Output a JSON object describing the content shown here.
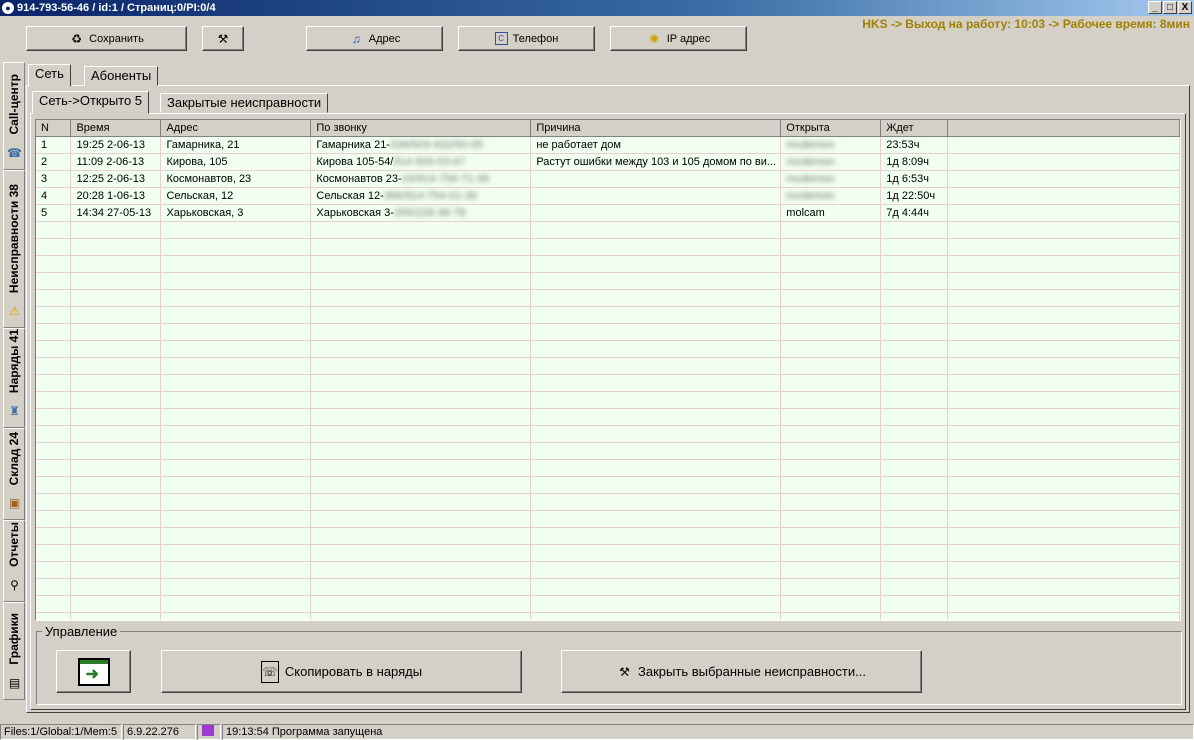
{
  "window": {
    "title": "914-793-56-46 / id:1 / Страниц:0/PI:0/4",
    "controls": [
      "_",
      "□",
      "X"
    ]
  },
  "header_status": "HKS -> Выход на работу: 10:03 -> Рабочее время: 8мин",
  "toolbar": {
    "save": "Сохранить",
    "address": "Адрес",
    "phone": "Телефон",
    "ip": "IP адрес"
  },
  "side_tabs": [
    {
      "label": "Call-центр"
    },
    {
      "label": "Неисправности 38"
    },
    {
      "label": "Наряды 41"
    },
    {
      "label": "Склад 24"
    },
    {
      "label": "Отчеты"
    },
    {
      "label": "Графики"
    }
  ],
  "tabs": [
    "Сеть",
    "Абоненты"
  ],
  "subtabs": [
    "Сеть->Открыто 5",
    "Закрытые неисправности"
  ],
  "table": {
    "columns": [
      "N",
      "Время",
      "Адрес",
      "По звонку",
      "Причина",
      "Открыта",
      "Ждет"
    ],
    "rows": [
      {
        "n": "1",
        "time": "19:25 2-06-13",
        "address": "Гамарника, 21",
        "call": "Гамарника 21-",
        "call_hidden": "336/503-432/50-05",
        "reason": "не работает дом",
        "opened": "mcdemon",
        "opened_hidden": true,
        "wait": "23:53ч"
      },
      {
        "n": "2",
        "time": "11:09 2-06-13",
        "address": "Кирова, 105",
        "call": "Кирова 105-54/",
        "call_hidden": "914-500-53-67",
        "reason": "Растут ошибки между 103 и 105 домом по ви...",
        "opened": "mcdemon",
        "opened_hidden": true,
        "wait": "1д 8:09ч"
      },
      {
        "n": "3",
        "time": "12:25 2-06-13",
        "address": "Космонавтов, 23",
        "call": "Космонавтов 23-",
        "call_hidden": "15/914-756-71-39",
        "reason": "",
        "opened": "mcdemon",
        "opened_hidden": true,
        "wait": "1д 6:53ч"
      },
      {
        "n": "4",
        "time": "20:28 1-06-13",
        "address": "Сельская, 12",
        "call": "Сельская 12-",
        "call_hidden": "366/914-754-01-30",
        "reason": "",
        "opened": "mcdemon",
        "opened_hidden": true,
        "wait": "1д 22:50ч"
      },
      {
        "n": "5",
        "time": "14:34 27-05-13",
        "address": "Харьковская, 3",
        "call": "Харьковская 3-",
        "call_hidden": "265/228-38-78",
        "reason": "",
        "opened": "molcam",
        "opened_hidden": false,
        "wait": "7д 4:44ч"
      }
    ]
  },
  "management": {
    "title": "Управление",
    "copy": "Скопировать в наряды",
    "close": "Закрыть выбранные неисправности..."
  },
  "statusbar": {
    "files": "Files:1/Global:1/Mem:5",
    "version": "6.9.22.276",
    "message": "19:13:54 Программа запущена"
  },
  "icons": {
    "save": "refresh-arrows-icon",
    "tool": "tools-icon",
    "address": "bell-icon",
    "phone": "phone-card-icon",
    "ip": "lightbulb-icon"
  }
}
